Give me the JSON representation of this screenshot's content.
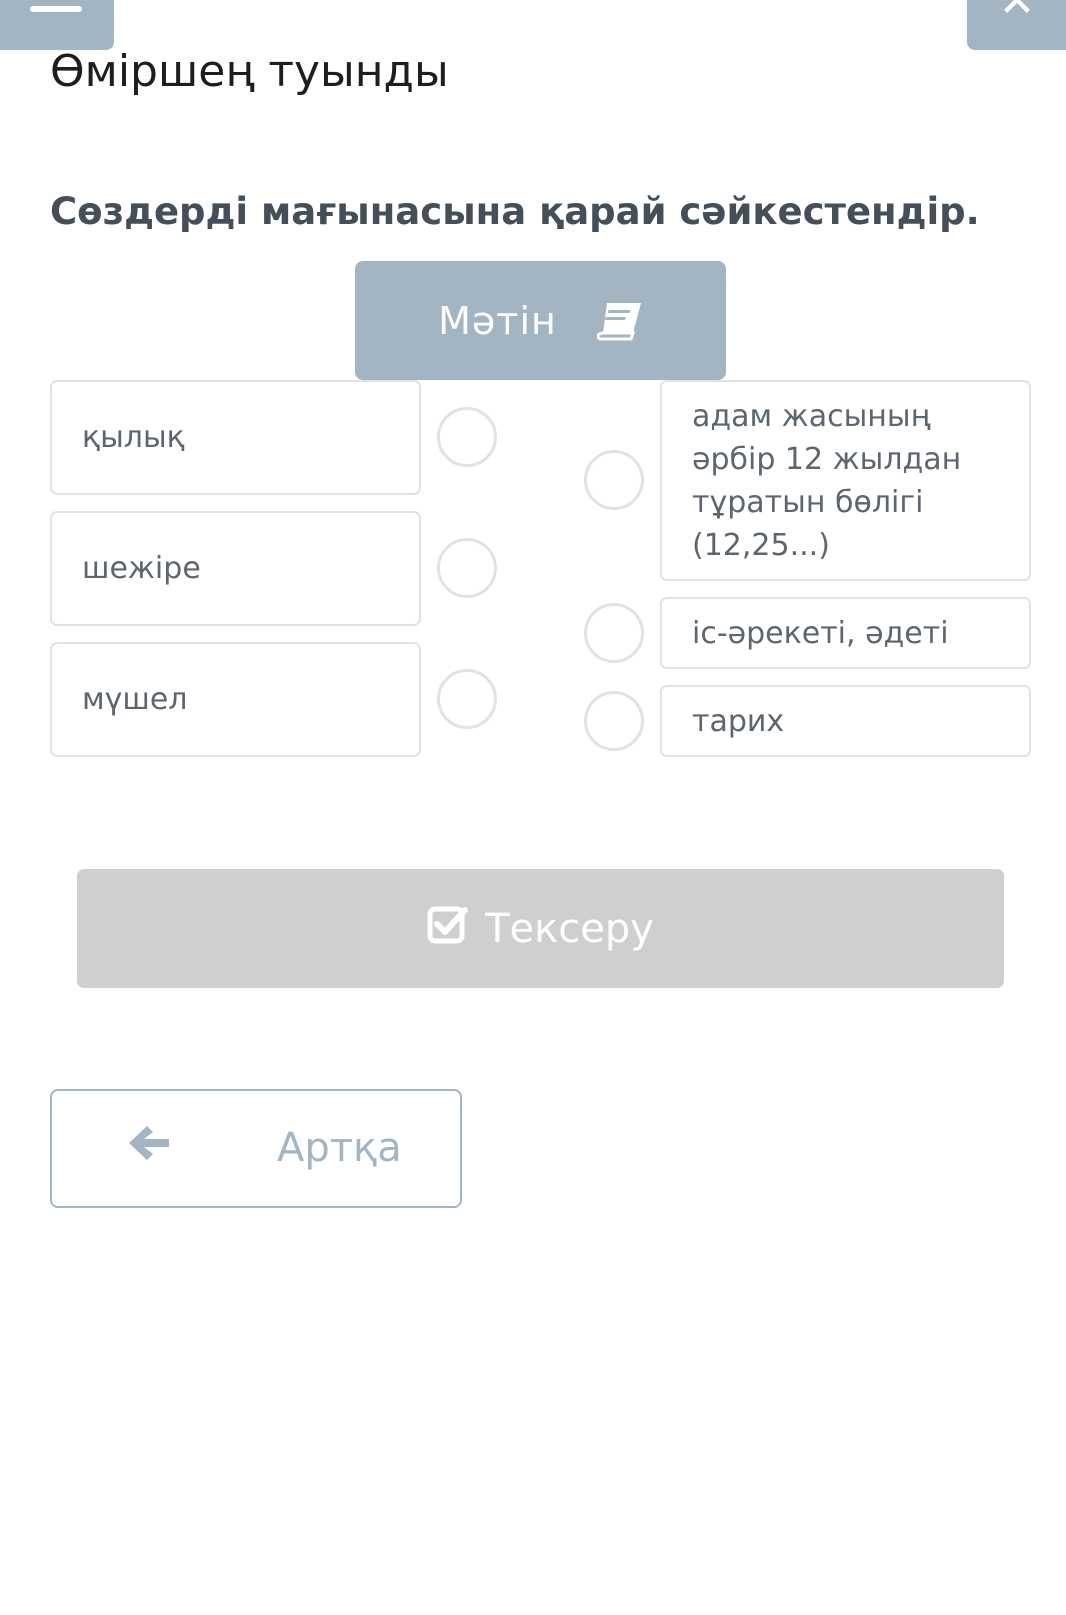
{
  "header": {
    "menu_icon": "hamburger-icon",
    "close_icon": "close-icon",
    "title": "Өміршең туынды"
  },
  "task": {
    "instruction": "Сөздерді мағынасына қарай сәйкестендір.",
    "text_button": {
      "label": "Мәтін",
      "icon": "book-icon"
    }
  },
  "matching": {
    "left_items": [
      {
        "label": "қылық"
      },
      {
        "label": "шежіре"
      },
      {
        "label": "мүшел"
      }
    ],
    "right_items": [
      {
        "label": "адам жасының әрбір 12 жылдан тұратын бөлігі (12,25...)"
      },
      {
        "label": "іс-әрекеті, әдеті"
      },
      {
        "label": "тарих"
      }
    ]
  },
  "actions": {
    "check_label": "Тексеру",
    "check_icon": "checkbox-icon",
    "back_label": "Артқа",
    "back_icon": "arrow-left-icon"
  },
  "colors": {
    "accent": "#a3b5c2",
    "disabled": "#cfcfcf",
    "border": "#dde3e8"
  }
}
